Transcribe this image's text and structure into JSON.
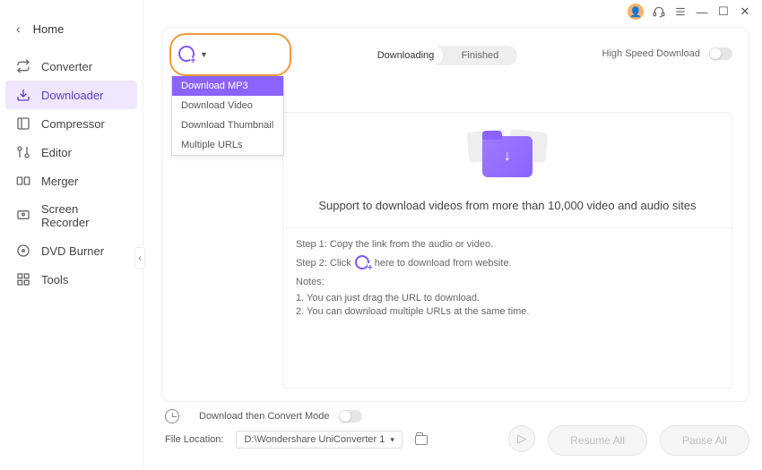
{
  "titlebar": {
    "minimize": "—",
    "maximize": "☐",
    "close": "✕"
  },
  "nav": {
    "home": "Home",
    "items": [
      {
        "label": "Converter"
      },
      {
        "label": "Downloader"
      },
      {
        "label": "Compressor"
      },
      {
        "label": "Editor"
      },
      {
        "label": "Merger"
      },
      {
        "label": "Screen Recorder"
      },
      {
        "label": "DVD Burner"
      },
      {
        "label": "Tools"
      }
    ]
  },
  "dropdown": {
    "items": [
      {
        "label": "Download MP3"
      },
      {
        "label": "Download Video"
      },
      {
        "label": "Download Thumbnail"
      },
      {
        "label": "Multiple URLs"
      }
    ]
  },
  "tabs": {
    "downloading": "Downloading",
    "finished": "Finished"
  },
  "hispeed_label": "High Speed Download",
  "content": {
    "support": "Support to download videos from more than 10,000 video and audio sites",
    "step1": "Step 1: Copy the link from the audio or video.",
    "step2_a": "Step 2: Click",
    "step2_b": "here to download from website.",
    "notes": "Notes:",
    "note1": "1. You can just drag the URL to download.",
    "note2": "2. You can download multiple URLs at the same time."
  },
  "footer": {
    "mode": "Download then Convert Mode",
    "loc_label": "File Location:",
    "loc_value": "D:\\Wondershare UniConverter 1",
    "resume": "Resume All",
    "pause": "Pause All"
  }
}
